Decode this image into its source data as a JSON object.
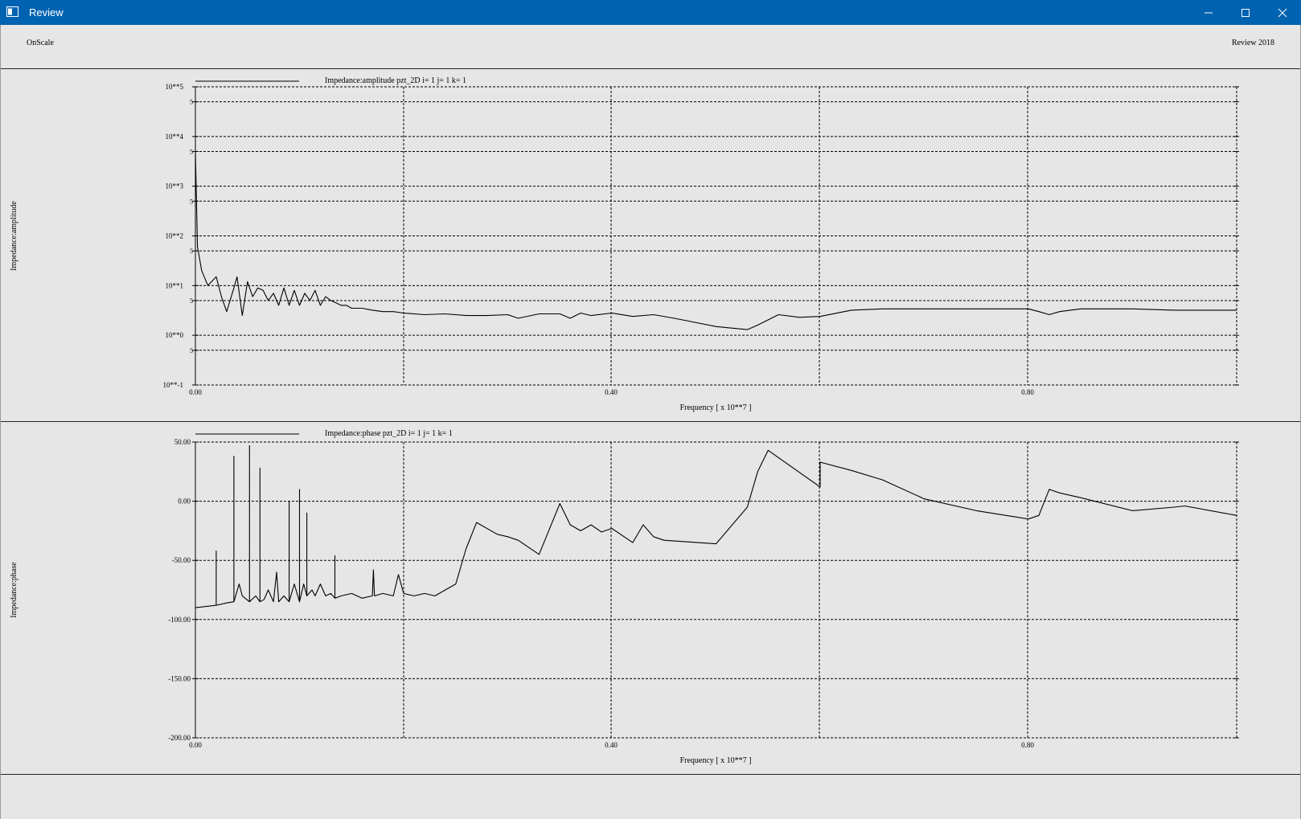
{
  "window": {
    "title": "Review"
  },
  "header": {
    "left_label": "OnScale",
    "right_label": "Review 2018"
  },
  "chart_data": [
    {
      "type": "line",
      "title": "Impedance:amplitude pzt_2D i= 1 j= 1 k= 1",
      "xlabel": "Frequency [ x 10**7 ]",
      "ylabel": "Impedance:amplitude",
      "xlim": [
        0,
        1.0
      ],
      "xticks": [
        "0.00",
        "0.40",
        "0.80"
      ],
      "yscale": "log",
      "ylim": [
        0.1,
        100000
      ],
      "yticks": [
        "10**5",
        "10**4",
        "10**3",
        "10**2",
        "10**1",
        "10**0",
        "10**-1"
      ],
      "minor_tick_label": "5",
      "grid": true,
      "x": [
        0.0,
        0.002,
        0.006,
        0.012,
        0.02,
        0.025,
        0.03,
        0.037,
        0.04,
        0.045,
        0.05,
        0.055,
        0.06,
        0.065,
        0.07,
        0.075,
        0.08,
        0.085,
        0.09,
        0.095,
        0.1,
        0.105,
        0.11,
        0.115,
        0.12,
        0.125,
        0.13,
        0.135,
        0.14,
        0.145,
        0.15,
        0.16,
        0.17,
        0.18,
        0.19,
        0.2,
        0.22,
        0.24,
        0.26,
        0.28,
        0.3,
        0.31,
        0.33,
        0.35,
        0.36,
        0.37,
        0.38,
        0.4,
        0.42,
        0.44,
        0.46,
        0.5,
        0.5,
        0.53,
        0.54,
        0.56,
        0.58,
        0.6,
        0.6,
        0.63,
        0.66,
        0.7,
        0.75,
        0.8,
        0.81,
        0.82,
        0.83,
        0.85,
        0.9,
        0.94,
        0.95,
        1.0
      ],
      "y": [
        5000,
        60,
        20,
        10,
        15,
        6,
        3,
        9,
        15,
        2.5,
        12,
        6,
        9,
        8,
        5,
        7,
        4,
        9,
        4,
        8,
        4,
        7,
        5,
        8,
        4,
        6,
        5,
        4.5,
        4,
        4,
        3.5,
        3.5,
        3.2,
        3,
        3,
        2.8,
        2.6,
        2.7,
        2.5,
        2.5,
        2.6,
        2.2,
        2.7,
        2.7,
        2.2,
        2.8,
        2.5,
        2.8,
        2.4,
        2.6,
        2.2,
        1.5,
        1.5,
        1.3,
        1.6,
        2.6,
        2.3,
        2.4,
        2.4,
        3.2,
        3.4,
        3.4,
        3.4,
        3.4,
        3.0,
        2.6,
        3.0,
        3.4,
        3.4,
        3.2,
        3.2,
        3.2
      ]
    },
    {
      "type": "line",
      "title": "Impedance:phase pzt_2D i= 1 j= 1 k= 1",
      "xlabel": "Frequency [ x 10**7 ]",
      "ylabel": "Impedance:phase",
      "xlim": [
        0,
        1.0
      ],
      "xticks": [
        "0.00",
        "0.40",
        "0.80"
      ],
      "ylim": [
        -200,
        50
      ],
      "yticks": [
        "50.00",
        "0.00",
        "-50.00",
        "-100.00",
        "-150.00",
        "-200.00"
      ],
      "grid": true,
      "x": [
        0.0,
        0.02,
        0.02,
        0.02,
        0.03,
        0.037,
        0.037,
        0.037,
        0.042,
        0.045,
        0.052,
        0.052,
        0.052,
        0.058,
        0.062,
        0.062,
        0.062,
        0.066,
        0.07,
        0.075,
        0.078,
        0.08,
        0.085,
        0.09,
        0.09,
        0.09,
        0.095,
        0.1,
        0.1,
        0.1,
        0.104,
        0.107,
        0.107,
        0.107,
        0.112,
        0.115,
        0.12,
        0.125,
        0.13,
        0.134,
        0.134,
        0.134,
        0.14,
        0.15,
        0.16,
        0.17,
        0.171,
        0.172,
        0.18,
        0.19,
        0.195,
        0.2,
        0.21,
        0.22,
        0.23,
        0.25,
        0.26,
        0.27,
        0.29,
        0.3,
        0.31,
        0.33,
        0.35,
        0.36,
        0.37,
        0.38,
        0.39,
        0.4,
        0.42,
        0.43,
        0.44,
        0.45,
        0.5,
        0.5,
        0.53,
        0.54,
        0.55,
        0.6,
        0.6,
        0.63,
        0.66,
        0.7,
        0.75,
        0.8,
        0.81,
        0.82,
        0.83,
        0.85,
        0.9,
        0.94,
        0.95,
        1.0
      ],
      "y": [
        -90,
        -88,
        -42,
        -88,
        -86,
        -85,
        38,
        -85,
        -70,
        -80,
        -85,
        47,
        -85,
        -80,
        -85,
        28,
        -85,
        -83,
        -75,
        -85,
        -60,
        -85,
        -80,
        -85,
        0,
        -85,
        -70,
        -85,
        10,
        -85,
        -70,
        -80,
        -10,
        -80,
        -75,
        -80,
        -70,
        -80,
        -78,
        -82,
        -46,
        -82,
        -80,
        -78,
        -82,
        -80,
        -58,
        -80,
        -78,
        -80,
        -62,
        -78,
        -80,
        -78,
        -80,
        -70,
        -40,
        -18,
        -28,
        -30,
        -33,
        -45,
        -2,
        -20,
        -25,
        -20,
        -26,
        -23,
        -35,
        -20,
        -30,
        -33,
        -36,
        -36,
        -5,
        25,
        43,
        12,
        33,
        26,
        18,
        2,
        -8,
        -15,
        -12,
        10,
        7,
        3,
        -8,
        -5,
        -4,
        -12
      ]
    }
  ]
}
